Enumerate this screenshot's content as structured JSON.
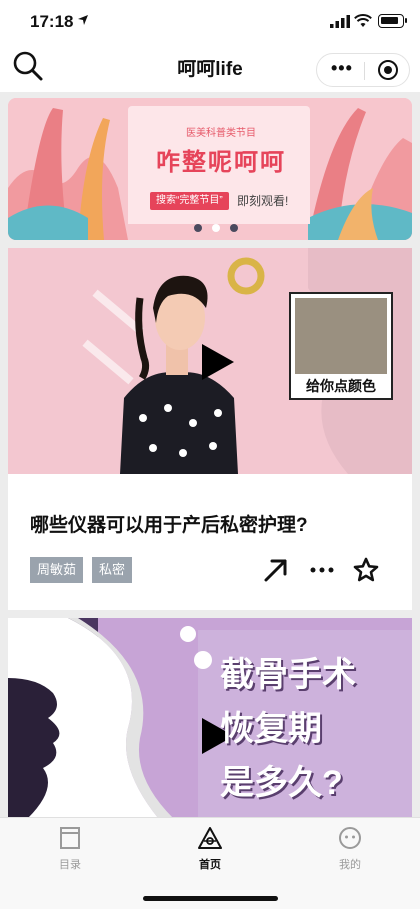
{
  "status": {
    "time": "17:18",
    "location_icon": "location-arrow-icon"
  },
  "nav": {
    "title": "呵呵life",
    "search_icon": "search-icon",
    "more_icon": "more-dots-icon",
    "close_icon": "target-circle-icon"
  },
  "banner": {
    "subtitle": "医美科普类节目",
    "headline": "咋整呢呵呵",
    "search_pill": "搜索“完整节目”",
    "watch_now": "即刻观看!",
    "dots_total": 3,
    "active_dot": 2
  },
  "card1": {
    "sticker_caption": "给你点颜色",
    "title": "哪些仪器可以用于产后私密护理?",
    "tags": [
      "周敏茹",
      "私密"
    ],
    "actions": {
      "share_icon": "share-arrow-icon",
      "more_icon": "more-horizontal-icon",
      "favorite_icon": "star-outline-icon"
    }
  },
  "card2": {
    "overlay_lines": [
      "截骨手术",
      "恢复期",
      "是多久?"
    ]
  },
  "tabbar": {
    "items": [
      {
        "label": "目录",
        "icon": "catalog-icon",
        "active": false
      },
      {
        "label": "首页",
        "icon": "home-triangle-icon",
        "active": true
      },
      {
        "label": "我的",
        "icon": "profile-face-icon",
        "active": false
      }
    ]
  },
  "colors": {
    "banner_accent": "#e6445a",
    "tag_bg": "#9aa3ad",
    "card2_bg": "#c9a6d8"
  }
}
